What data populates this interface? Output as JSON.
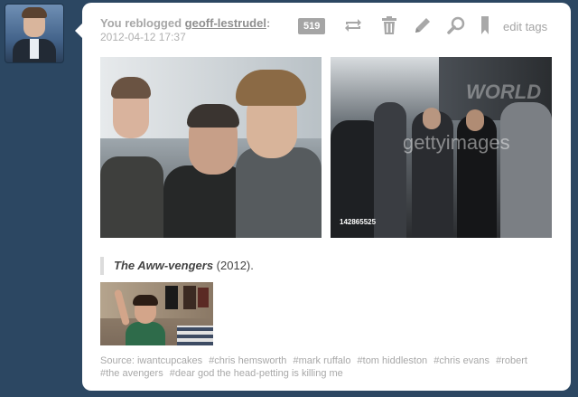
{
  "reblog": {
    "prefix": "You reblogged",
    "user": "geoff-lestrudel",
    "suffix": ":",
    "timestamp": "2012-04-12 17:37"
  },
  "controls": {
    "notes_count": "519",
    "edit_tags_label": "edit tags",
    "icons": [
      "reblog-icon",
      "delete-icon",
      "edit-icon",
      "search-icon",
      "bookmark-icon"
    ]
  },
  "photos": {
    "photo2_watermark": "WORLD",
    "photo2_getty": "gettyimages",
    "photo2_number": "142865525"
  },
  "caption": {
    "title": "The Aww-vengers",
    "year": "(2012)."
  },
  "tags_line": [
    "Source: iwantcupcakes",
    "#chris hemsworth",
    "#mark ruffalo",
    "#tom hiddleston",
    "#chris evans",
    "#robert",
    "#the avengers",
    "#dear god the head-petting is killing me"
  ],
  "colors": {
    "background": "#2c4762",
    "post_bg": "#ffffff",
    "notes_badge": "#a5a5a5",
    "meta_text": "#a8a8a8"
  }
}
